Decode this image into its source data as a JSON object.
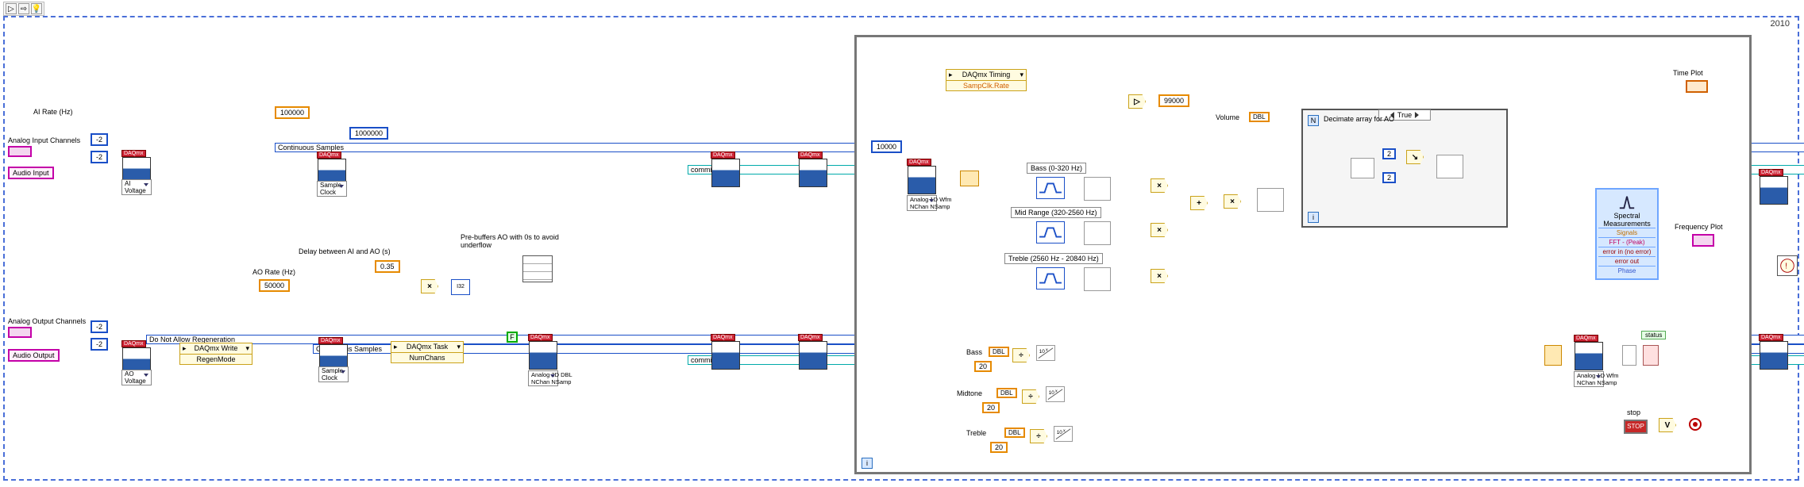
{
  "toolbar": {
    "run": "▷",
    "cont": "⇨",
    "highlight": "💡"
  },
  "year": "2010",
  "labels": {
    "ai_rate": "AI Rate (Hz)",
    "ao_rate": "AO Rate (Hz)",
    "ai_channels": "Analog Input Channels",
    "ao_channels": "Analog Output Channels",
    "audio_in": "Audio Input",
    "audio_out": "Audio Output",
    "delay": "Delay between AI and AO (s)",
    "prebuf": "Pre-buffers AO with 0s to avoid underflow",
    "time_plot": "Time Plot",
    "freq_plot": "Frequency Plot",
    "stop": "stop",
    "status": "status",
    "volume": "Volume",
    "decimate": "Decimate array for AO"
  },
  "constants": {
    "hundk": "100000",
    "onemil": "1000000",
    "fiftyk": "50000",
    "delay": "0.35",
    "neg2a": "-2",
    "neg2b": "-2",
    "neg2c": "-2",
    "neg2d": "-2",
    "tenk": "10000",
    "ninetynine": "99000",
    "two_a": "2",
    "two_b": "2",
    "bass_n": "20",
    "mid_n": "20",
    "treb_n": "20"
  },
  "rings": {
    "ai_voltage": "AI Voltage",
    "ao_voltage": "AO Voltage",
    "cont_samp1": "Continuous Samples",
    "cont_samp2": "Continuous Samples",
    "samp_clock1": "Sample Clock",
    "samp_clock2": "Sample Clock",
    "no_regen": "Do Not Allow Regeneration",
    "commit1": "commit",
    "commit2": "commit"
  },
  "props": {
    "regen": "DAQmx Write",
    "regen_sub": "RegenMode",
    "task": "DAQmx Task",
    "numchans": "NumChans",
    "timing": "DAQmx Timing",
    "sampclkrate": "SampClk.Rate"
  },
  "daqmx_labels": {
    "a2d": "Analog 2D DBL\nNChan NSamp",
    "a1d_in": "Analog 1D Wfm\nNChan NSamp",
    "a1d_out": "Analog 1D Wfm\nNChan NSamp"
  },
  "bands": {
    "bass": "Bass (0-320 Hz)",
    "mid": "Mid Range (320-2560 Hz)",
    "treble": "Treble (2560 Hz - 20840 Hz)"
  },
  "controls": {
    "bass": "Bass",
    "mid": "Midtone",
    "treble": "Treble"
  },
  "express": {
    "title": "Spectral Measurements",
    "signals": "Signals",
    "fft": "FFT - (Peak)",
    "errin": "error in (no error)",
    "errout": "error out",
    "phase": "Phase"
  },
  "case": {
    "true": "True"
  },
  "stop_btn": "STOP",
  "bool": {
    "F": "F"
  }
}
